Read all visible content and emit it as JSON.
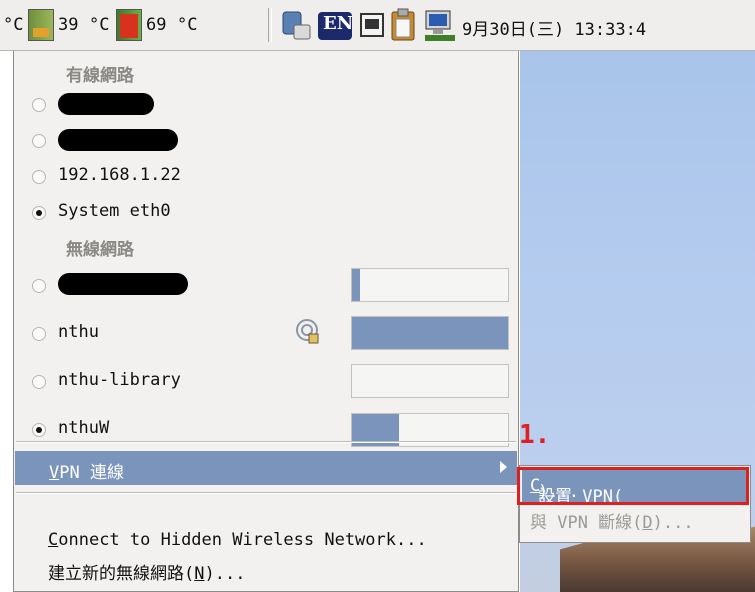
{
  "panel": {
    "temp1_unit": "°C",
    "temp2_value": "39",
    "temp2_unit": "°C",
    "temp3_value": "69",
    "temp3_unit": "°C",
    "keyboard_layout": "EN",
    "clock": "9月30日(三) 13:33:4"
  },
  "menu": {
    "wired_header": "有線網路",
    "wired_connections": [
      {
        "label": "",
        "redacted": true,
        "selected": false
      },
      {
        "label": "",
        "redacted": true,
        "selected": false
      },
      {
        "label": "192.168.1.22",
        "redacted": false,
        "selected": false
      },
      {
        "label": "System eth0",
        "redacted": false,
        "selected": true
      }
    ],
    "wireless_header": "無線網路",
    "wireless_networks": [
      {
        "label": "",
        "redacted": true,
        "selected": false,
        "signal": 0.05,
        "secured": false
      },
      {
        "label": "nthu",
        "redacted": false,
        "selected": false,
        "signal": 1.0,
        "secured": true
      },
      {
        "label": "nthu-library",
        "redacted": false,
        "selected": false,
        "signal": 0.0,
        "secured": false
      },
      {
        "label": "nthuW",
        "redacted": false,
        "selected": true,
        "signal": 0.3,
        "secured": false
      }
    ],
    "vpn": {
      "label_mnemonic": "V",
      "label_rest": "PN 連線"
    },
    "hidden": {
      "mnemonic": "C",
      "rest": "onnect to Hidden Wireless Network..."
    },
    "new_wireless": {
      "before": "建立新的無線網路(",
      "mnemonic": "N",
      "after": ")..."
    }
  },
  "submenu": {
    "configure": {
      "before": "設置 VPN(",
      "mnemonic": "C",
      "after": ")..."
    },
    "disconnect": {
      "before": "與 VPN 斷線(",
      "mnemonic": "D",
      "after": ")..."
    }
  },
  "annotation": {
    "step_label": "1.",
    "color": "#e02020"
  },
  "colors": {
    "selection": "#7b94bb",
    "menu_bg": "#f2f1ef",
    "panel_bg": "#efeeec"
  }
}
